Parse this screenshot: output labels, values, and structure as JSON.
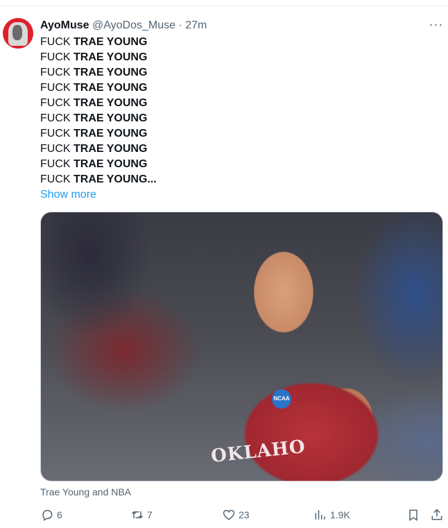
{
  "tweet": {
    "display_name": "AyoMuse",
    "handle": "@AyoDos_Muse",
    "separator": "·",
    "time": "27m",
    "more_icon": "···",
    "lines": [
      {
        "a": "FUCK ",
        "b": "TRAE YOUNG"
      },
      {
        "a": "FUCK ",
        "b": "TRAE YOUNG"
      },
      {
        "a": "FUCK ",
        "b": "TRAE YOUNG"
      },
      {
        "a": "FUCK ",
        "b": "TRAE YOUNG"
      },
      {
        "a": "FUCK ",
        "b": "TRAE YOUNG"
      },
      {
        "a": "FUCK ",
        "b": "TRAE YOUNG"
      },
      {
        "a": "FUCK ",
        "b": "TRAE YOUNG"
      },
      {
        "a": "FUCK ",
        "b": "TRAE YOUNG"
      },
      {
        "a": "FUCK ",
        "b": "TRAE YOUNG"
      },
      {
        "a": "FUCK ",
        "b": "TRAE YOUNG..."
      }
    ],
    "show_more": "Show more",
    "media": {
      "badge_text": "NCAA",
      "jersey_text": "OKLAHO"
    },
    "caption": "Trae Young and NBA"
  },
  "actions": {
    "replies": "6",
    "retweets": "7",
    "likes": "23",
    "views": "1.9K"
  },
  "icons": {
    "reply": "reply-icon",
    "retweet": "retweet-icon",
    "like": "heart-icon",
    "views": "views-icon",
    "bookmark": "bookmark-icon",
    "share": "share-icon"
  },
  "colors": {
    "link": "#1d9bf0",
    "secondary_text": "#536471",
    "avatar_bg": "#e0212b"
  }
}
